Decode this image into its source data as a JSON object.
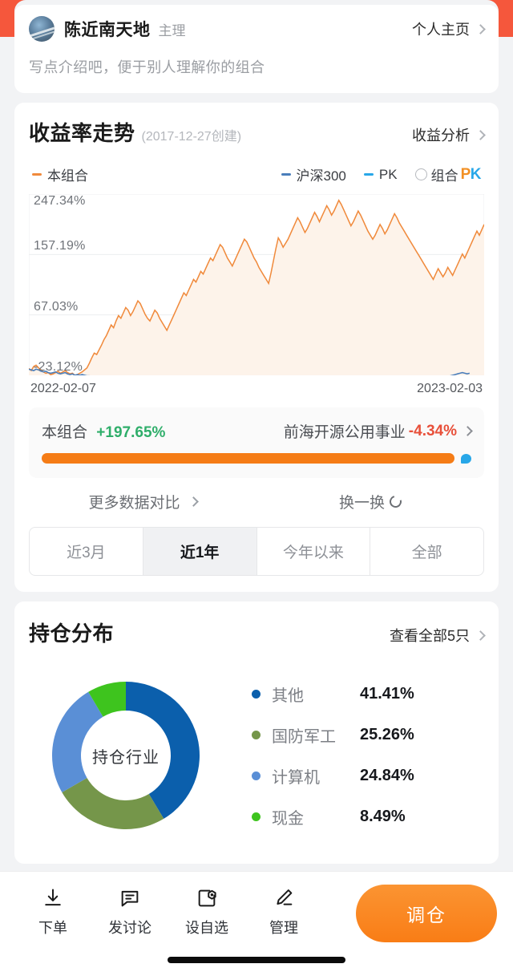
{
  "profile": {
    "username": "陈近南天地",
    "role": "主理",
    "homepage_label": "个人主页",
    "description": "写点介绍吧，便于别人理解你的组合"
  },
  "chart_section": {
    "title": "收益率走势",
    "subtitle": "(2017-12-27创建)",
    "analysis_label": "收益分析",
    "legend": [
      {
        "label": "本组合",
        "color": "#f08a3c",
        "marker": "dash"
      },
      {
        "label": "沪深300",
        "color": "#4a7ebb",
        "marker": "dash"
      },
      {
        "label": "PK",
        "color": "#28a7e8",
        "marker": "dash"
      },
      {
        "label": "组合",
        "color": "#3a3d42",
        "marker": "radio"
      }
    ],
    "pk_logo": {
      "p": "P",
      "k": "K",
      "p_color": "#f29024",
      "k_color": "#28a7e8"
    },
    "compare": {
      "left_name": "本组合",
      "left_value": "+197.65%",
      "left_color": "#2fae6a",
      "right_name": "前海开源公用事业",
      "right_value": "-4.34%",
      "right_color": "#e8503a"
    },
    "actions": {
      "more_compare": "更多数据对比",
      "shuffle": "换一换"
    },
    "range_tabs": [
      {
        "label": "近3月",
        "active": false
      },
      {
        "label": "近1年",
        "active": true
      },
      {
        "label": "今年以来",
        "active": false
      },
      {
        "label": "全部",
        "active": false
      }
    ]
  },
  "chart_data": {
    "type": "line",
    "title": "收益率走势",
    "xlabel": "",
    "ylabel": "",
    "x_ticks": [
      "2022-02-07",
      "2023-02-03"
    ],
    "y_ticks": [
      "247.34%",
      "157.19%",
      "67.03%",
      "-23.12%"
    ],
    "ylim": [
      -23.12,
      247.34
    ],
    "grid": true,
    "legend_position": "top",
    "series": [
      {
        "name": "本组合",
        "color": "#f08a3c",
        "filled": true,
        "values": [
          -13,
          -16,
          -10,
          -8,
          -12,
          -15,
          -18,
          -20,
          -19,
          -22,
          -21,
          -19,
          -17,
          -20,
          -18,
          -16,
          -19,
          -21,
          -20,
          -23,
          -22,
          -20,
          -18,
          -15,
          -12,
          -5,
          3,
          10,
          8,
          15,
          22,
          30,
          36,
          44,
          52,
          48,
          58,
          66,
          62,
          70,
          78,
          74,
          66,
          72,
          80,
          88,
          84,
          76,
          68,
          62,
          58,
          66,
          74,
          70,
          62,
          56,
          50,
          44,
          52,
          60,
          68,
          76,
          84,
          92,
          100,
          96,
          104,
          112,
          120,
          116,
          124,
          132,
          128,
          136,
          144,
          152,
          148,
          156,
          164,
          172,
          168,
          160,
          152,
          146,
          140,
          148,
          156,
          164,
          172,
          180,
          176,
          168,
          160,
          152,
          146,
          138,
          132,
          126,
          120,
          114,
          130,
          148,
          166,
          182,
          176,
          168,
          174,
          180,
          188,
          196,
          204,
          212,
          206,
          198,
          190,
          196,
          204,
          212,
          220,
          214,
          206,
          214,
          222,
          230,
          224,
          216,
          222,
          230,
          238,
          232,
          224,
          216,
          208,
          200,
          206,
          214,
          222,
          216,
          208,
          200,
          192,
          186,
          180,
          186,
          194,
          202,
          196,
          188,
          194,
          202,
          210,
          218,
          212,
          204,
          198,
          192,
          186,
          180,
          174,
          168,
          162,
          156,
          150,
          144,
          138,
          132,
          126,
          120,
          128,
          136,
          130,
          124,
          130,
          138,
          132,
          126,
          134,
          142,
          150,
          158,
          152,
          160,
          168,
          176,
          184,
          192,
          186,
          194,
          202
        ]
      },
      {
        "name": "沪深300",
        "color": "#4a7ebb",
        "filled": false,
        "values": [
          -14,
          -15,
          -16,
          -14,
          -15,
          -17,
          -18,
          -17,
          -19,
          -20,
          -19,
          -18,
          -20,
          -21,
          -20,
          -19,
          -21,
          -22,
          -21,
          -23,
          -22,
          -23,
          -22,
          -23,
          -24,
          -24,
          -25,
          -25,
          -26,
          -25,
          -26,
          -27,
          -26,
          -27,
          -28,
          -27,
          -28,
          -27,
          -28,
          -29,
          -28,
          -29,
          -28,
          -29,
          -30,
          -29,
          -30,
          -31,
          -30,
          -31,
          -30,
          -31,
          -32,
          -31,
          -32,
          -33,
          -32,
          -31,
          -32,
          -31,
          -30,
          -31,
          -32,
          -31,
          -30,
          -31,
          -30,
          -31,
          -30,
          -31,
          -32,
          -31,
          -32,
          -33,
          -32,
          -33,
          -34,
          -33,
          -34,
          -35,
          -34,
          -35,
          -36,
          -35,
          -36,
          -35,
          -34,
          -35,
          -34,
          -33,
          -34,
          -35,
          -36,
          -37,
          -38,
          -39,
          -40,
          -41,
          -40,
          -41,
          -40,
          -39,
          -38,
          -37,
          -38,
          -39,
          -38,
          -37,
          -36,
          -35,
          -36,
          -35,
          -34,
          -35,
          -36,
          -35,
          -34,
          -33,
          -32,
          -33,
          -34,
          -33,
          -32,
          -31,
          -32,
          -33,
          -32,
          -31,
          -30,
          -31,
          -32,
          -33,
          -34,
          -35,
          -34,
          -33,
          -32,
          -33,
          -34,
          -35,
          -34,
          -33,
          -32,
          -31,
          -30,
          -29,
          -28,
          -29,
          -30,
          -29,
          -28,
          -27,
          -28,
          -29,
          -30,
          -31,
          -32,
          -33,
          -34,
          -35,
          -34,
          -33,
          -32,
          -33,
          -34,
          -33,
          -32,
          -31,
          -30,
          -29,
          -28,
          -27,
          -26,
          -25,
          -24,
          -23,
          -22,
          -21,
          -20,
          -19,
          -20,
          -21,
          -20
        ]
      }
    ]
  },
  "holdings": {
    "title": "持仓分布",
    "view_all_label": "查看全部5只",
    "donut_center": "持仓行业",
    "items": [
      {
        "name": "其他",
        "value": "41.41%",
        "pct": 41.41,
        "color": "#0b5fac"
      },
      {
        "name": "国防军工",
        "value": "25.26%",
        "pct": 25.26,
        "color": "#75964a"
      },
      {
        "name": "计算机",
        "value": "24.84%",
        "pct": 24.84,
        "color": "#5a8fd6"
      },
      {
        "name": "现金",
        "value": "8.49%",
        "pct": 8.49,
        "color": "#3ec41e"
      }
    ]
  },
  "bottom_bar": {
    "nav": [
      {
        "label": "下单",
        "icon": "download-icon"
      },
      {
        "label": "发讨论",
        "icon": "comment-icon"
      },
      {
        "label": "设自选",
        "icon": "watchlist-icon"
      },
      {
        "label": "管理",
        "icon": "edit-icon"
      }
    ],
    "cta_label": "调仓"
  }
}
